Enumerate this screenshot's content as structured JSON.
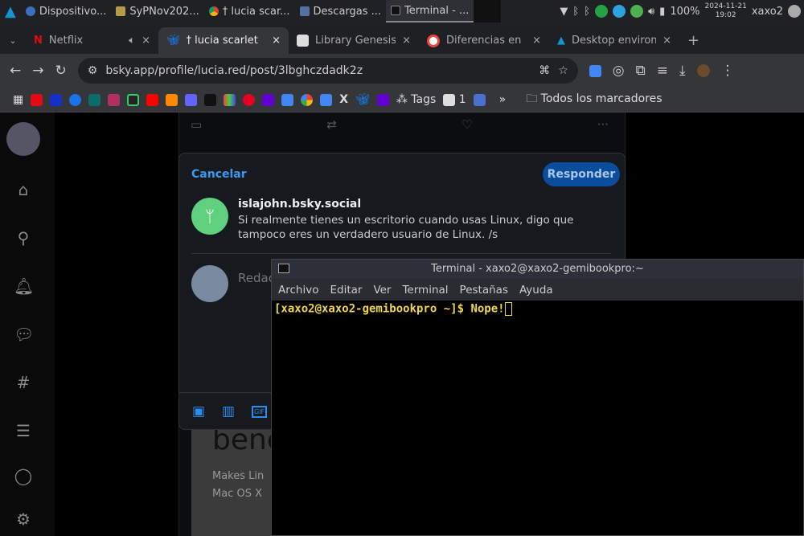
{
  "taskbar": {
    "items": [
      "Dispositivo...",
      "SyPNov202...",
      "† lucia scar...",
      "Descargas ...",
      "Terminal - ..."
    ],
    "battery": "100%",
    "date": "2024-11-21",
    "time": "19:02",
    "user": "xaxo2"
  },
  "tabs": [
    {
      "label": "Netflix",
      "icon": "netflix-icon"
    },
    {
      "label": "† lucia scarlet",
      "icon": "bluesky-icon",
      "active": true
    },
    {
      "label": "Library Genesis",
      "icon": "libgen-icon"
    },
    {
      "label": "Diferencias en",
      "icon": "site-icon"
    },
    {
      "label": "Desktop environ",
      "icon": "arch-icon"
    }
  ],
  "toolbar": {
    "url": "bsky.app/profile/lucia.red/post/3lbghczdadk2z"
  },
  "bookmarks": {
    "tags": "Tags",
    "one": "1",
    "more": "»",
    "all": "Todos los marcadores"
  },
  "dialog": {
    "cancel": "Cancelar",
    "reply": "Responder",
    "author": "islajohn.bsky.social",
    "text": "Si realmente tienes un escritorio cuando usas Linux, digo que tampoco eres un verdadero usuario de Linux. /s",
    "placeholder": "Redacta una respuesta"
  },
  "background_page": {
    "heading": "benc",
    "line1": "Makes Lin",
    "line2": "Mac OS X"
  },
  "terminal": {
    "title": "Terminal - xaxo2@xaxo2-gemibookpro:~",
    "menu": [
      "Archivo",
      "Editar",
      "Ver",
      "Terminal",
      "Pestañas",
      "Ayuda"
    ],
    "prompt": "[xaxo2@xaxo2-gemibookpro ~]$ ",
    "input": "Nope!"
  },
  "colors": {
    "accent": "#3b9af0",
    "reply_button": "#0a4d9c",
    "terminal_text": "#f2d64b"
  }
}
